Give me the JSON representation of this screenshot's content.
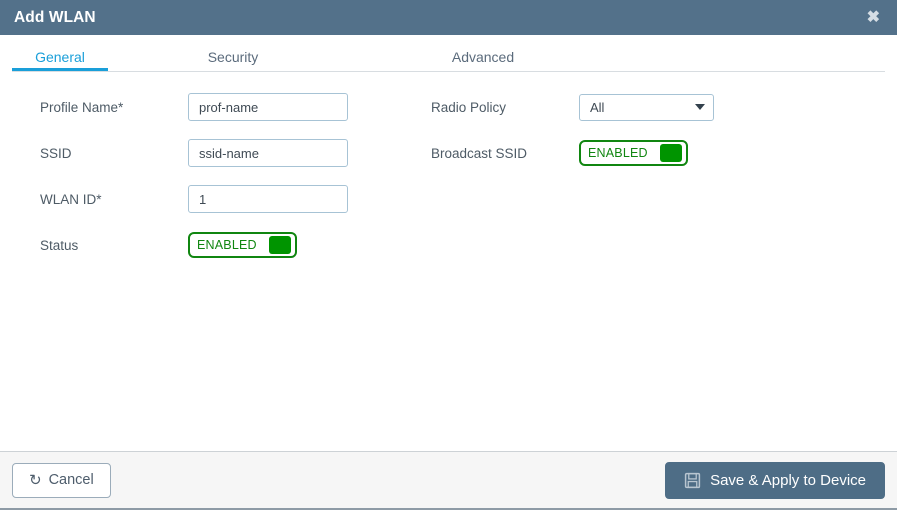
{
  "window": {
    "title": "Add WLAN",
    "close_icon": "close-icon",
    "close_glyph": "✖",
    "header_color": "#53718a"
  },
  "tabs": {
    "active": "General",
    "items": [
      {
        "label": "General",
        "active": true
      },
      {
        "label": "Security",
        "active": false
      },
      {
        "label": "Advanced",
        "active": false
      }
    ],
    "active_color": "#1a9fd9"
  },
  "form": {
    "left": {
      "profile_name": {
        "label": "Profile Name*",
        "value": "prof-name",
        "placeholder": ""
      },
      "ssid": {
        "label": "SSID",
        "value": "ssid-name",
        "placeholder": ""
      },
      "wlan_id": {
        "label": "WLAN ID*",
        "value": "1",
        "placeholder": ""
      },
      "status": {
        "label": "Status",
        "toggle_label": "ENABLED",
        "state": "enabled",
        "color": "#108610"
      }
    },
    "right": {
      "radio_policy": {
        "label": "Radio Policy",
        "value": "All",
        "caret_icon": "chevron-down-icon"
      },
      "broadcast_ssid": {
        "label": "Broadcast SSID",
        "toggle_label": "ENABLED",
        "state": "enabled",
        "color": "#108610"
      }
    }
  },
  "footer": {
    "cancel": {
      "label": "Cancel",
      "icon": "undo-icon",
      "glyph": "↺"
    },
    "save": {
      "label": "Save & Apply to Device",
      "icon": "floppy-disk-save-icon",
      "color": "#4e6d86"
    }
  }
}
